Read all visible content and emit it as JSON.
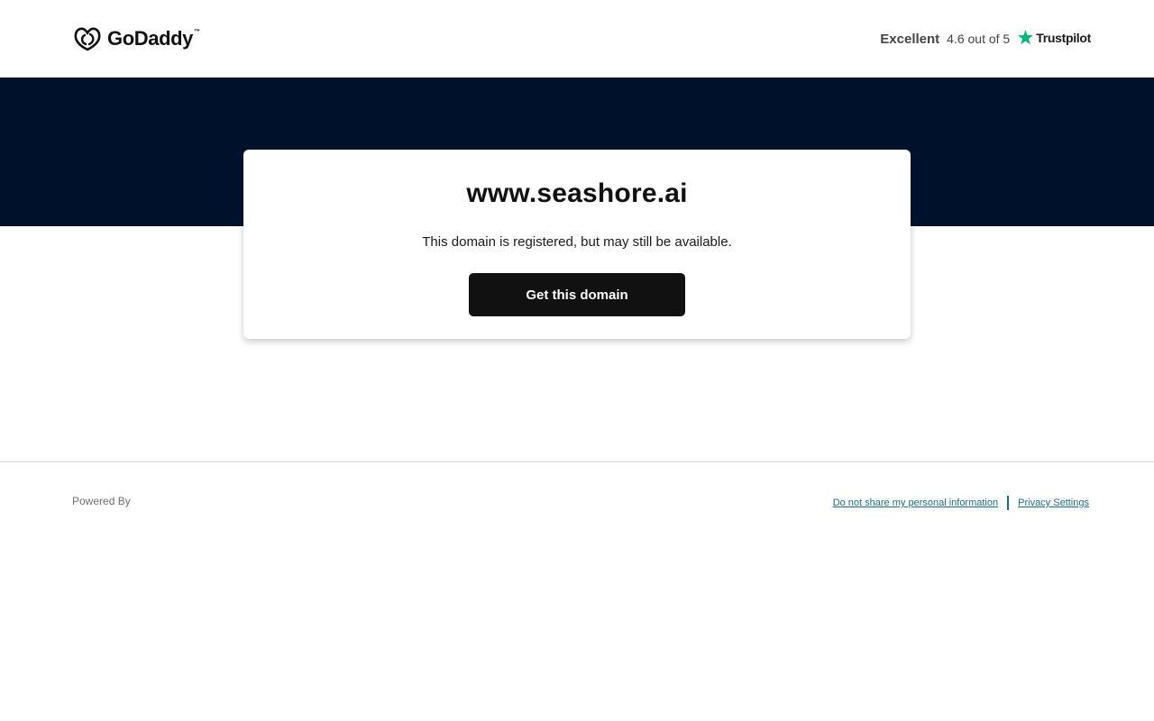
{
  "header": {
    "logo_text": "GoDaddy",
    "logo_tm": "™",
    "logo_icon": "godaddy-logo-icon",
    "rating_word": "Excellent",
    "rating_score": "4.6 out of 5",
    "rating_icon": "trustpilot-star-icon",
    "rating_brand": "Trustpilot"
  },
  "card": {
    "domain": "www.seashore.ai",
    "subtitle": "This domain is registered, but may still be available.",
    "cta_label": "Get this domain"
  },
  "footer": {
    "powered_by": "Powered By",
    "links": [
      "Do not share my personal information",
      "Privacy Settings"
    ]
  },
  "colors": {
    "banner": "#00122b",
    "button": "#111111",
    "trustpilot_green": "#00b67a",
    "footer_link": "#1d6f7a"
  }
}
